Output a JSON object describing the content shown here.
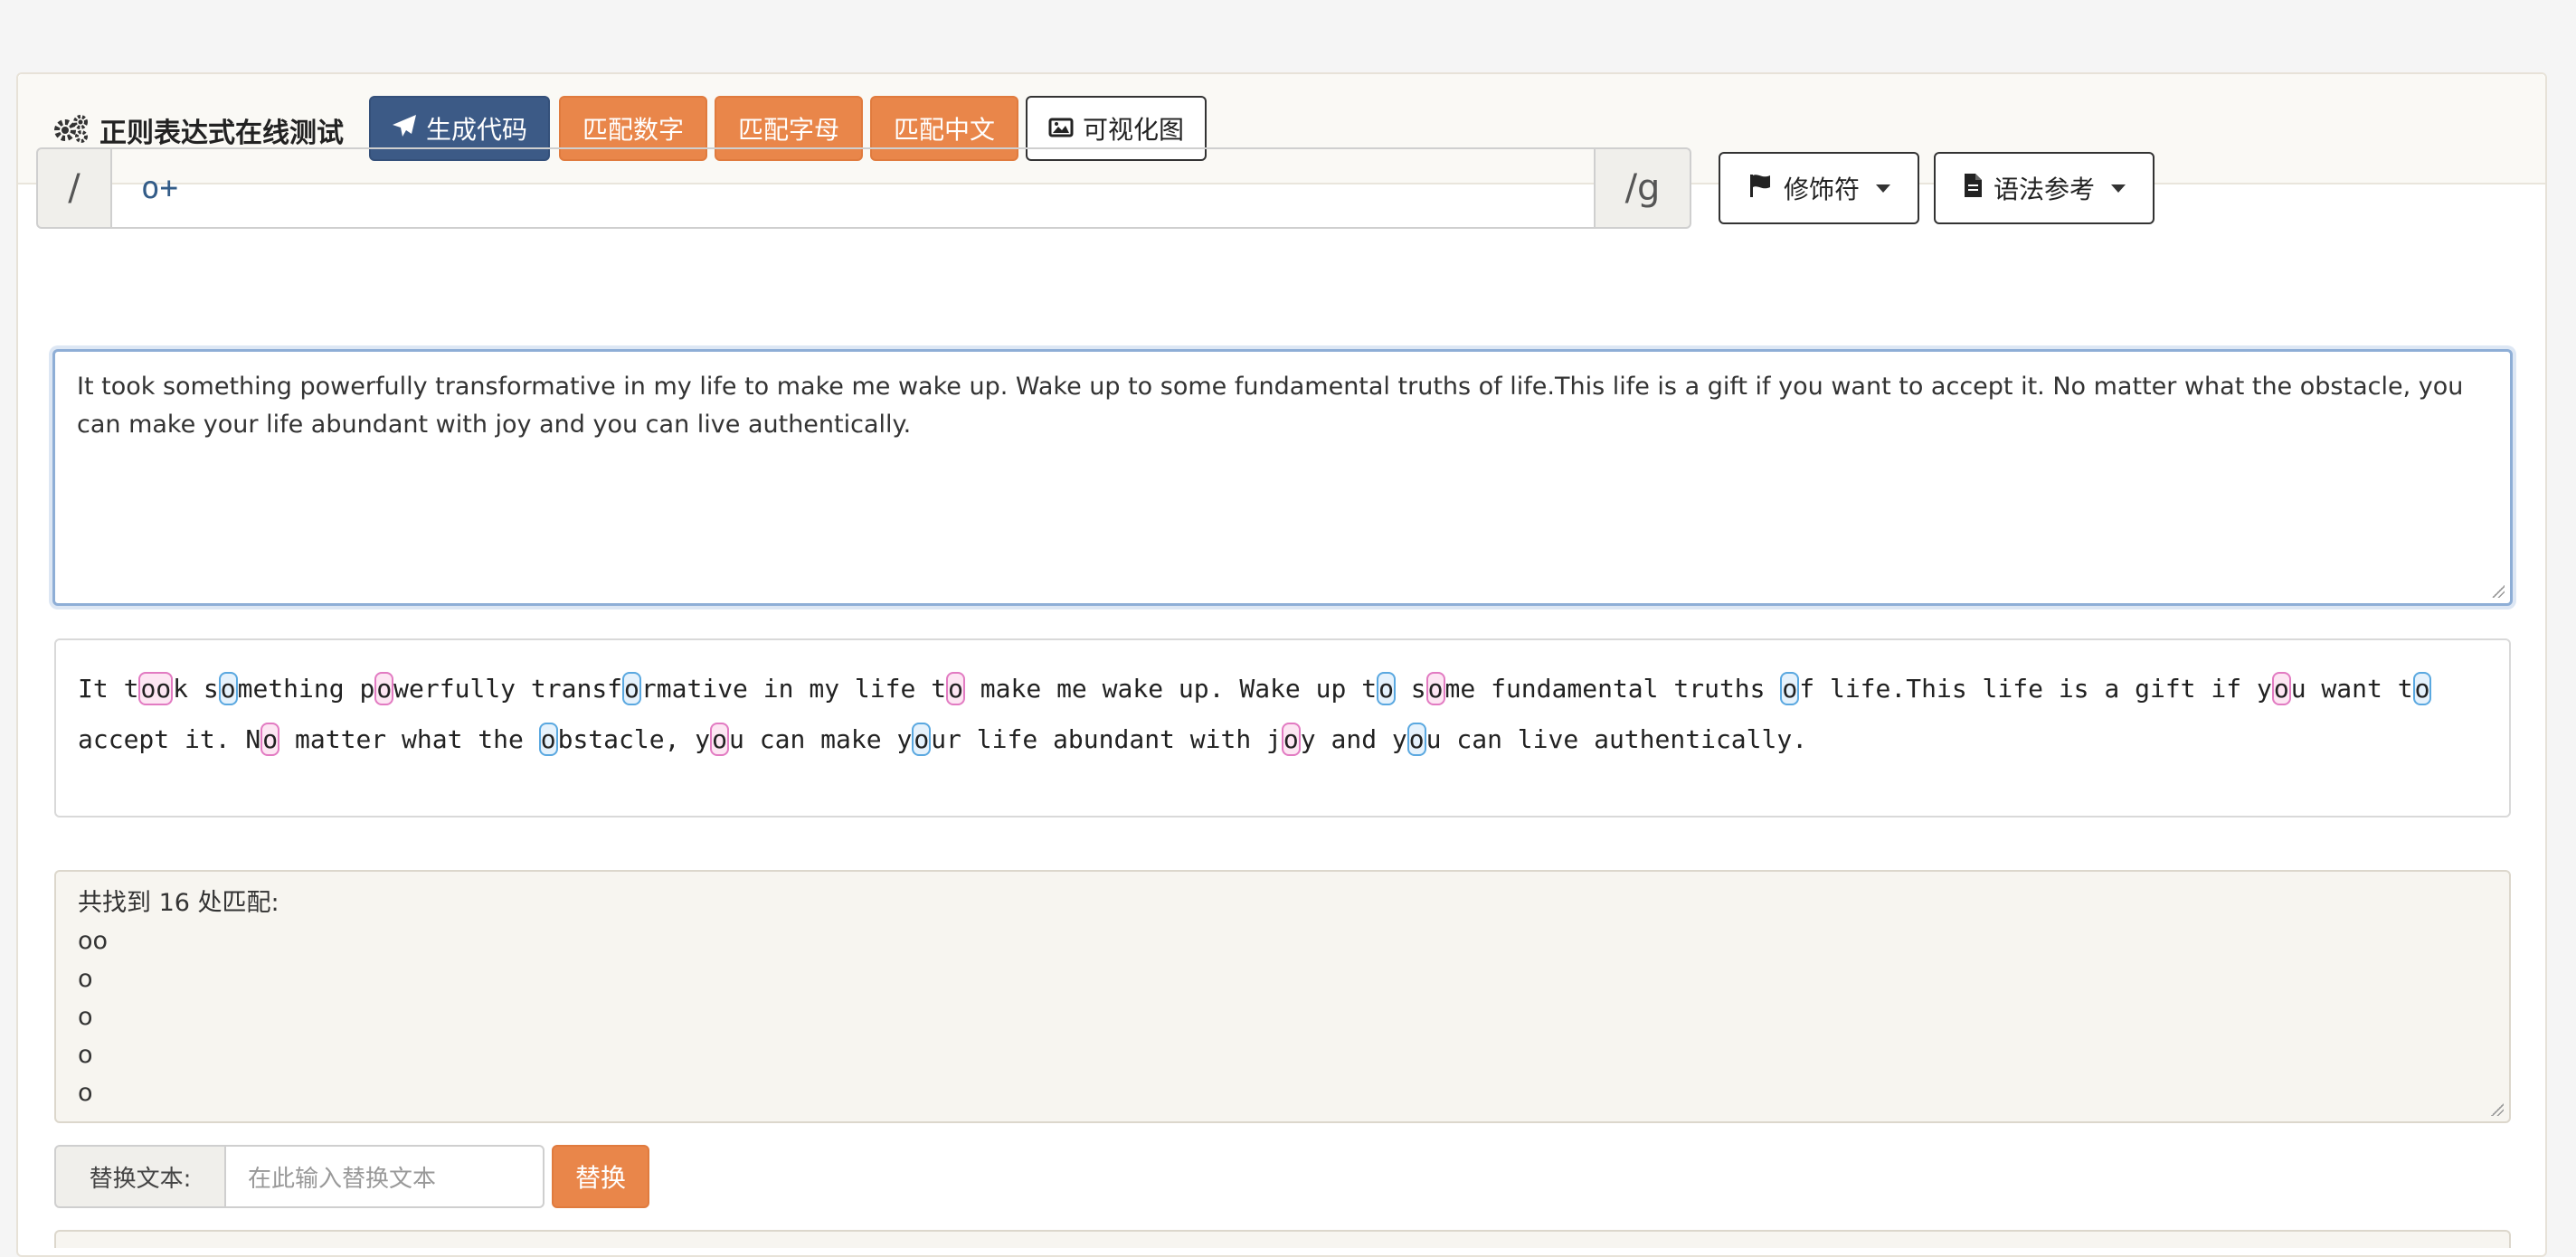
{
  "header": {
    "title": "正则表达式在线测试",
    "buttons": {
      "generate_code": "生成代码",
      "match_number": "匹配数字",
      "match_letter": "匹配字母",
      "match_chinese": "匹配中文",
      "visualize": "可视化图"
    }
  },
  "regex": {
    "prefix": "/",
    "pattern": "o+",
    "flags": "/g",
    "modifier_label": "修饰符",
    "syntax_label": "语法参考"
  },
  "input_text": "It took something powerfully transformative in my life to make me wake up. Wake up to some fundamental truths of life.This life is a gift if you want to accept it. No matter what the obstacle, you can make your life abundant with joy and you can live authentically.",
  "highlight_segments": [
    {
      "t": "It t"
    },
    {
      "m": "oo",
      "c": "pink"
    },
    {
      "t": "k s"
    },
    {
      "m": "o",
      "c": "blue"
    },
    {
      "t": "mething p"
    },
    {
      "m": "o",
      "c": "pink"
    },
    {
      "t": "werfully transf"
    },
    {
      "m": "o",
      "c": "blue"
    },
    {
      "t": "rmative in my life t"
    },
    {
      "m": "o",
      "c": "pink"
    },
    {
      "t": " make me wake up. Wake up t"
    },
    {
      "m": "o",
      "c": "blue"
    },
    {
      "t": " s"
    },
    {
      "m": "o",
      "c": "pink"
    },
    {
      "t": "me fundamental truths "
    },
    {
      "m": "o",
      "c": "blue"
    },
    {
      "t": "f life.This life is a gift if y"
    },
    {
      "m": "o",
      "c": "pink"
    },
    {
      "t": "u want t"
    },
    {
      "m": "o",
      "c": "blue"
    },
    {
      "t": "\naccept it. N"
    },
    {
      "m": "o",
      "c": "pink"
    },
    {
      "t": " matter what the "
    },
    {
      "m": "o",
      "c": "blue"
    },
    {
      "t": "bstacle, y"
    },
    {
      "m": "o",
      "c": "pink"
    },
    {
      "t": "u can make y"
    },
    {
      "m": "o",
      "c": "blue"
    },
    {
      "t": "ur life abundant with j"
    },
    {
      "m": "o",
      "c": "pink"
    },
    {
      "t": "y and y"
    },
    {
      "m": "o",
      "c": "blue"
    },
    {
      "t": "u can live authentically."
    }
  ],
  "results": {
    "summary": "共找到 16 处匹配:",
    "lines": [
      "oo",
      "o",
      "o",
      "o",
      "o"
    ]
  },
  "replace": {
    "label": "替换文本:",
    "placeholder": "在此输入替换文本",
    "button": "替换"
  }
}
